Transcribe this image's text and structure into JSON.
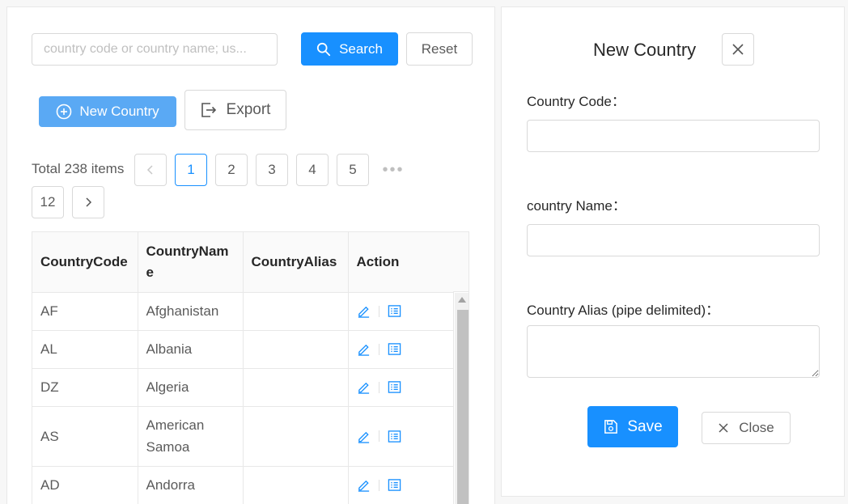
{
  "search": {
    "placeholder": "country code or country name; us...",
    "search_label": "Search",
    "reset_label": "Reset"
  },
  "toolbar": {
    "new_label": "New Country",
    "export_label": "Export"
  },
  "pagination": {
    "total_text": "Total 238 items",
    "pages": [
      "1",
      "2",
      "3",
      "4",
      "5"
    ],
    "ellipsis": "•••",
    "last_page": "12",
    "current": "1"
  },
  "table": {
    "headers": [
      "CountryCode",
      "CountryName",
      "CountryAlias",
      "Action"
    ],
    "rows": [
      {
        "code": "AF",
        "name": "Afghanistan",
        "alias": ""
      },
      {
        "code": "AL",
        "name": "Albania",
        "alias": ""
      },
      {
        "code": "DZ",
        "name": "Algeria",
        "alias": ""
      },
      {
        "code": "AS",
        "name": "American Samoa",
        "alias": ""
      },
      {
        "code": "AD",
        "name": "Andorra",
        "alias": ""
      }
    ]
  },
  "drawer": {
    "title": "New Country",
    "fields": {
      "code_label": "Country Code：",
      "code_value": "",
      "name_label": "country Name：",
      "name_value": "",
      "alias_label": "Country Alias (pipe delimited)：",
      "alias_value": ""
    },
    "save_label": "Save",
    "close_label": "Close"
  },
  "colors": {
    "primary": "#1890ff",
    "primary_light": "#5aa9f4",
    "border": "#d9d9d9"
  },
  "icons": {
    "search": "search-icon",
    "new": "plus-circle-icon",
    "export": "export-icon",
    "edit": "edit-icon",
    "detail": "list-detail-icon",
    "close": "close-icon",
    "save": "save-icon"
  }
}
